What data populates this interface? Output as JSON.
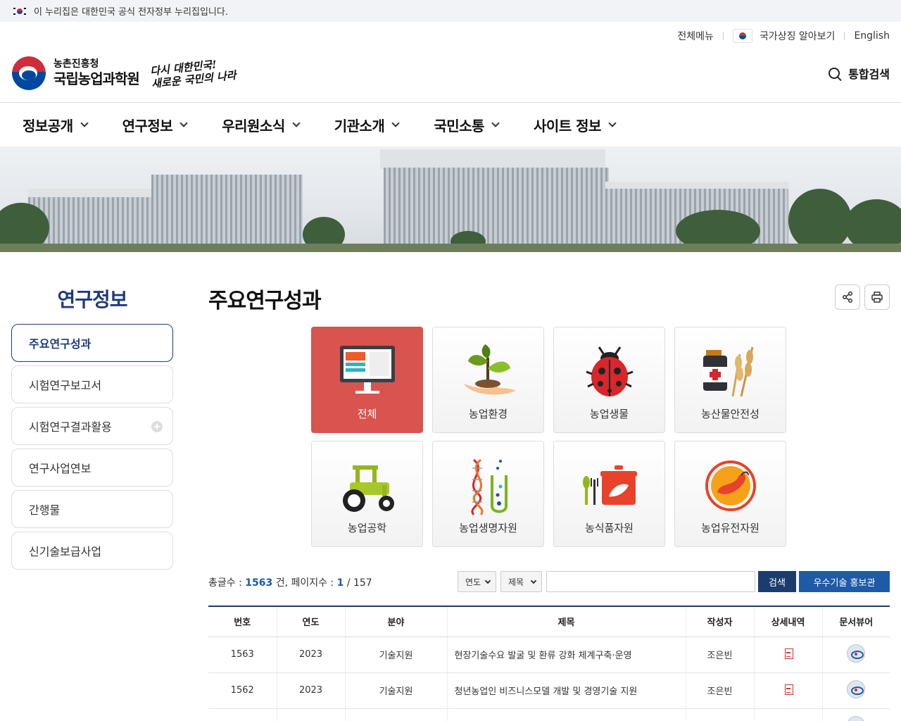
{
  "gov_banner": {
    "text": "이 누리집은 대한민국 공식 전자정부 누리집입니다."
  },
  "util": {
    "all_menu": "전체메뉴",
    "national_symbol": "국가상징 알아보기",
    "english": "English"
  },
  "logo": {
    "sub": "농촌진흥청",
    "main": "국립농업과학원",
    "slogan_line1": "다시 대한민국!",
    "slogan_line2": "새로운 국민의 나라"
  },
  "header": {
    "search_label": "통합검색"
  },
  "gnb": [
    "정보공개",
    "연구정보",
    "우리원소식",
    "기관소개",
    "국민소통",
    "사이트 정보"
  ],
  "lnb": {
    "title": "연구정보",
    "items": [
      "주요연구성과",
      "시험연구보고서",
      "시험연구결과활용",
      "연구사업연보",
      "간행물",
      "신기술보급사업"
    ]
  },
  "content": {
    "title": "주요연구성과",
    "categories": [
      "전체",
      "농업환경",
      "농업생물",
      "농산물안전성",
      "농업공학",
      "농업생명자원",
      "농식품자원",
      "농업유전자원"
    ],
    "count": {
      "label_total": "총글수 :",
      "total": "1563",
      "unit": "건,",
      "label_pages": "페이지수 :",
      "page": "1",
      "pages": "/ 157"
    },
    "search": {
      "year_select": "연도",
      "field_select": "제목",
      "search_button": "검색",
      "promo_button": "우수기술 홍보관"
    },
    "table": {
      "headers": [
        "번호",
        "연도",
        "분야",
        "제목",
        "작성자",
        "상세내역",
        "문서뷰어"
      ],
      "rows": [
        {
          "no": "1563",
          "year": "2023",
          "field": "기술지원",
          "title": "현장기술수요 발굴 및 환류 강화 체계구축·운영",
          "author": "조은빈"
        },
        {
          "no": "1562",
          "year": "2023",
          "field": "기술지원",
          "title": "청년농업인 비즈니스모델 개발 및 경영기술 지원",
          "author": "조은빈"
        }
      ]
    }
  },
  "colors": {
    "accent_navy": "#1e3a7b",
    "button_dark": "#1c3c6e",
    "button_blue": "#1e5aa8",
    "active_category": "#d9534f"
  }
}
